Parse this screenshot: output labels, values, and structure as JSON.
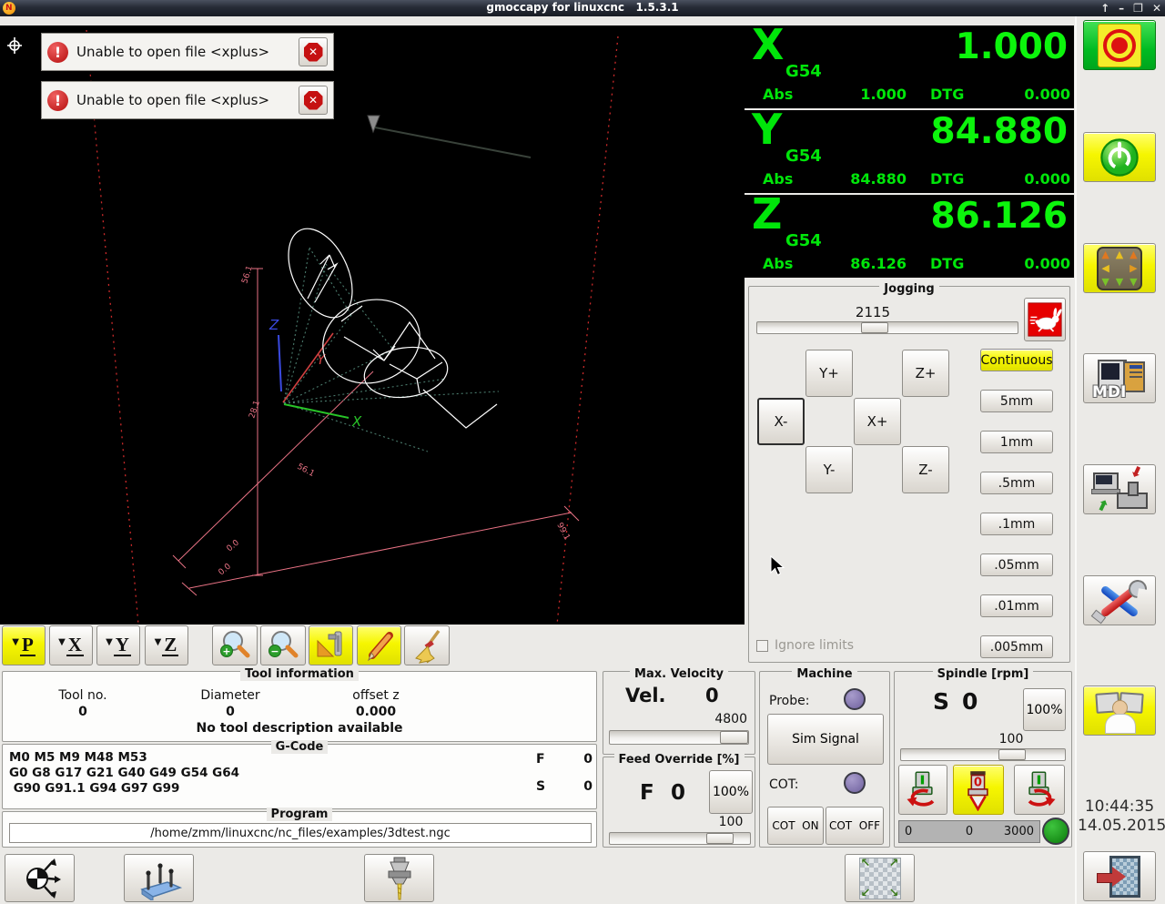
{
  "window": {
    "title": "gmoccapy for linuxcnc   1.5.3.1",
    "shade": "↑",
    "minimize": "–",
    "restore": "❐",
    "close": "✕"
  },
  "icons": {
    "exclamation": "!",
    "close": "✕",
    "plus": "+",
    "minus": "−",
    "up": "▲",
    "down": "▼",
    "left": "◀",
    "right": "▶",
    "nw": "↖",
    "ne": "↗",
    "sw": "↙",
    "se": "↘",
    "red_down": "⬇",
    "green_up": "⬆"
  },
  "toasts": [
    {
      "text": "Unable to open file <xplus>"
    },
    {
      "text": "Unable to open file <xplus>"
    }
  ],
  "preview": {
    "axis_x": "X",
    "axis_y": "Y",
    "axis_z": "Z",
    "dim_z_top": "56.1",
    "dim_z_mid": "28.1",
    "dim_zero_a": "0.0",
    "dim_zero_b": "0.0",
    "dim_y_mid": "56.1",
    "dim_x_end": "99.1"
  },
  "dro": {
    "axes": [
      {
        "letter": "X",
        "system": "G54",
        "value": "1.000",
        "abs_label": "Abs",
        "abs": "1.000",
        "dtg_label": "DTG",
        "dtg": "0.000"
      },
      {
        "letter": "Y",
        "system": "G54",
        "value": "84.880",
        "abs_label": "Abs",
        "abs": "84.880",
        "dtg_label": "DTG",
        "dtg": "0.000"
      },
      {
        "letter": "Z",
        "system": "G54",
        "value": "86.126",
        "abs_label": "Abs",
        "abs": "86.126",
        "dtg_label": "DTG",
        "dtg": "0.000"
      }
    ]
  },
  "jogging": {
    "title": "Jogging",
    "speed_value": "2115",
    "y_plus": "Y+",
    "z_plus": "Z+",
    "x_minus": "X-",
    "x_plus": "X+",
    "y_minus": "Y-",
    "z_minus": "Z-",
    "increments": [
      "Continuous",
      "5mm",
      "1mm",
      ".5mm",
      ".1mm",
      ".05mm",
      ".01mm",
      ".005mm"
    ],
    "ignore_limits": "Ignore limits"
  },
  "viewbar": {
    "p": "P",
    "x": "X",
    "y": "Y",
    "z": "Z"
  },
  "tool_info": {
    "title": "Tool information",
    "tool_no_label": "Tool no.",
    "tool_no": "0",
    "diameter_label": "Diameter",
    "diameter": "0",
    "offset_z_label": "offset z",
    "offset_z": "0.000",
    "description": "No tool description available"
  },
  "gcode": {
    "title": "G-Code",
    "line1": "M0 M5 M9 M48 M53",
    "line2": "G0 G8 G17 G21 G40 G49 G54 G64",
    "line3": " G90 G91.1 G94 G97 G99",
    "f_label": "F",
    "f_value": "0",
    "s_label": "S",
    "s_value": "0"
  },
  "program": {
    "title": "Program",
    "path": "/home/zmm/linuxcnc/nc_files/examples/3dtest.ngc"
  },
  "max_velocity": {
    "title": "Max. Velocity",
    "vel_label": "Vel.",
    "vel_value": "0",
    "slider_value": "4800"
  },
  "feed_override": {
    "title": "Feed Override [%]",
    "f_label": "F",
    "f_value": "0",
    "percent": "100%",
    "slider_value": "100"
  },
  "machine": {
    "title": "Machine",
    "probe_label": "Probe:",
    "sim_signal": "Sim Signal",
    "cot_label": "COT:",
    "cot_on": "COT  ON",
    "cot_off": "COT  OFF"
  },
  "spindle": {
    "title": "Spindle [rpm]",
    "s_label": "S",
    "s_value": "0",
    "percent": "100%",
    "slider_value": "100",
    "bar_left": "0",
    "bar_mid": "0",
    "bar_right": "3000"
  },
  "sidebar": {
    "mdi_label": "MDI",
    "clock_time": "10:44:35",
    "clock_date": "14.05.2015"
  }
}
